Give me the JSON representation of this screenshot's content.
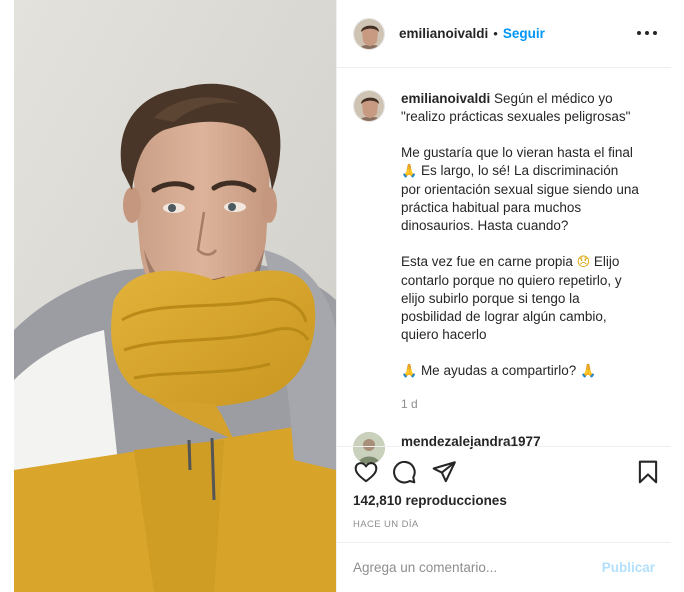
{
  "post": {
    "username": "emilianoivaldi",
    "follow_label": "Seguir",
    "separator": "•",
    "more_options_icon": "more-horizontal-icon"
  },
  "caption": {
    "username": "emilianoivaldi",
    "line1": "Según el médico yo \"realizo prácticas sexuales peligrosas\"",
    "p2_before_emoji": "Me gustaría que lo vieran hasta el final ",
    "p2_emoji": "🙏",
    "p2_after_emoji": " Es largo, lo sé! La discriminación por orientación sexual sigue siendo una práctica habitual para muchos dinosaurios. Hasta cuando?",
    "p3_before_emoji": "Esta vez fue en carne propia ",
    "p3_emoji": "😞",
    "p3_after_emoji": " Elijo contarlo porque no quiero repetirlo, y elijo subirlo porque si tengo la posbilidad de lograr algún cambio, quiero hacerlo",
    "p4_emoji_start": "🙏",
    "p4_text": " Me ayudas a compartirlo? ",
    "p4_emoji_end": "🙏",
    "time_ago": "1 d"
  },
  "comment_preview": {
    "username": "mendezalejandra1977"
  },
  "actions": {
    "like_icon": "heart-icon",
    "comment_icon": "comment-icon",
    "share_icon": "send-icon",
    "save_icon": "bookmark-icon",
    "views": "142,810 reproducciones",
    "posted": "HACE UN DÍA"
  },
  "add_comment": {
    "placeholder": "Agrega un comentario...",
    "publish_label": "Publicar"
  },
  "colors": {
    "accent": "#0095f6",
    "publish_disabled": "#b2dffc",
    "muted": "#8e8e8e",
    "text": "#262626",
    "border": "#efefef"
  }
}
